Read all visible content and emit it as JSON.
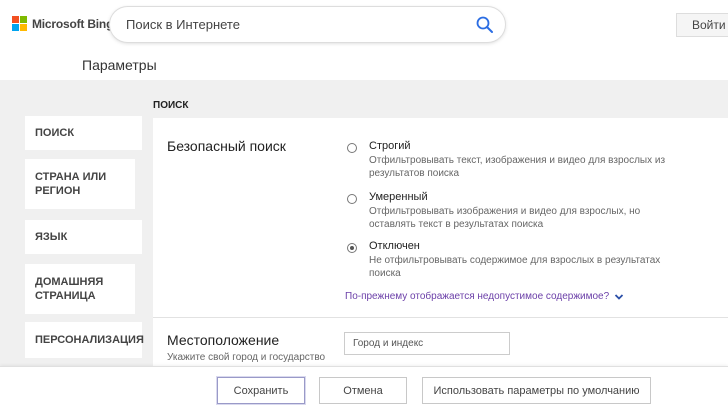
{
  "header": {
    "logo_text": "Microsoft Bing",
    "search_placeholder": "Поиск в Интернете",
    "signin_label": "Войти"
  },
  "page_title": "Параметры",
  "sidebar": {
    "items": [
      {
        "label": "ПОИСК"
      },
      {
        "label": "СТРАНА ИЛИ РЕГИОН"
      },
      {
        "label": "ЯЗЫК"
      },
      {
        "label": "ДОМАШНЯЯ СТРАНИЦА"
      },
      {
        "label": "ПЕРСОНАЛИЗАЦИЯ"
      }
    ]
  },
  "section_label": "ПОИСК",
  "safe_search": {
    "title": "Безопасный поиск",
    "options": [
      {
        "title": "Строгий",
        "description": "Отфильтровывать текст, изображения и видео для взрослых из результатов поиска",
        "checked": false
      },
      {
        "title": "Умеренный",
        "description": "Отфильтровывать изображения и видео для взрослых, но оставлять текст в результатах поиска",
        "checked": false
      },
      {
        "title": "Отключен",
        "description": "Не отфильтровывать содержимое для взрослых в результатах поиска",
        "checked": true
      }
    ],
    "more_link": "По-прежнему отображается недопустимое содержимое?"
  },
  "location": {
    "title": "Местоположение",
    "subtitle": "Укажите свой город и государство",
    "input_placeholder": "Город и индекс"
  },
  "footer": {
    "save_label": "Сохранить",
    "cancel_label": "Отмена",
    "defaults_label": "Использовать параметры по умолчанию"
  },
  "colors": {
    "ms_red": "#f25022",
    "ms_green": "#7fba00",
    "ms_blue": "#00a4ef",
    "ms_yellow": "#ffb900",
    "link_purple": "#6b3fa8",
    "search_icon_blue": "#2b6de3"
  },
  "icons": {
    "search": "search-icon",
    "chevron": "chevron-down-icon"
  }
}
